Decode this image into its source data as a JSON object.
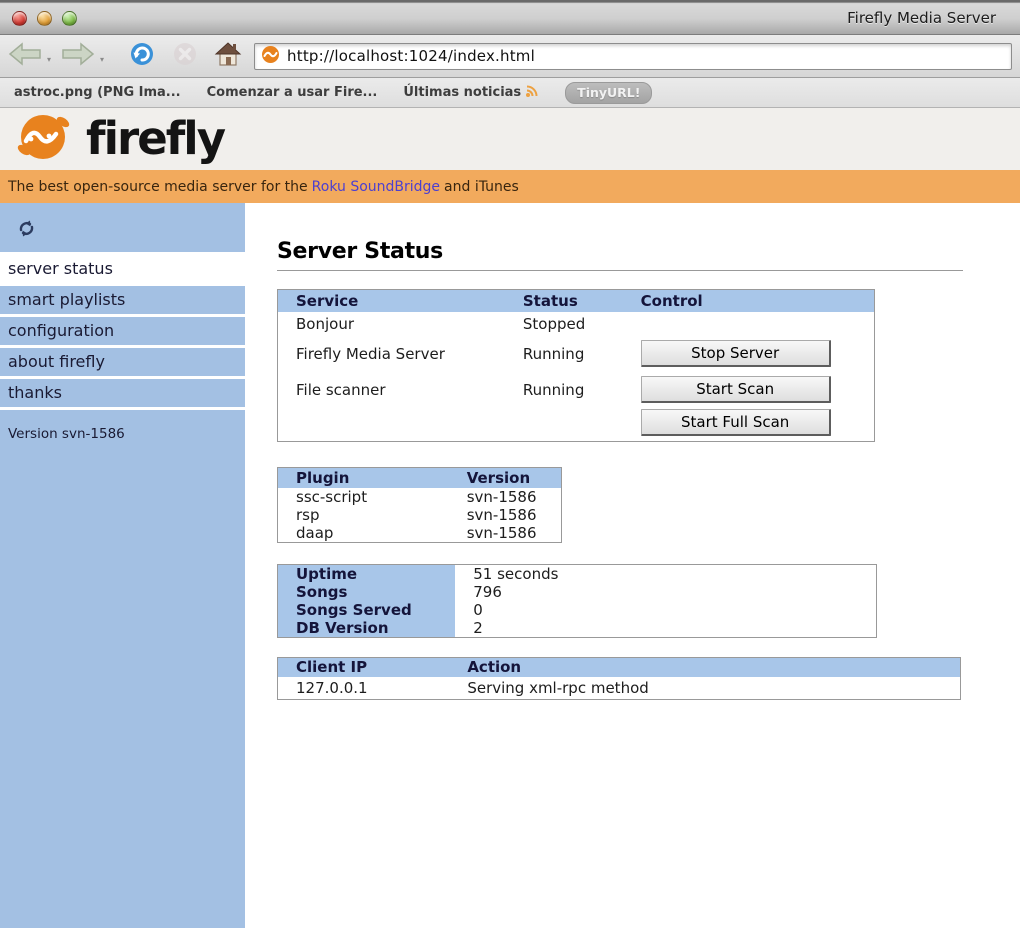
{
  "window": {
    "title": "Firefly Media Server"
  },
  "browser": {
    "url": "http://localhost:1024/index.html",
    "bookmarks": [
      {
        "label": "astroc.png (PNG Ima..."
      },
      {
        "label": "Comenzar a usar Fire..."
      },
      {
        "label": "Últimas noticias"
      },
      {
        "label": "TinyURL!"
      }
    ]
  },
  "logo": {
    "wordmark": "firefly"
  },
  "banner": {
    "prefix": "The best open-source media server for the",
    "link": "Roku SoundBridge",
    "suffix": "and iTunes"
  },
  "sidebar": {
    "items": [
      {
        "label": "server status",
        "selected": true
      },
      {
        "label": "smart playlists",
        "selected": false
      },
      {
        "label": "configuration",
        "selected": false
      },
      {
        "label": "about firefly",
        "selected": false
      },
      {
        "label": "thanks",
        "selected": false
      }
    ],
    "version": "Version svn-1586"
  },
  "main": {
    "title": "Server Status",
    "service_table": {
      "headers": {
        "service": "Service",
        "status": "Status",
        "control": "Control"
      },
      "rows": [
        {
          "service": "Bonjour",
          "status": "Stopped",
          "control": ""
        },
        {
          "service": "Firefly Media Server",
          "status": "Running",
          "control": "Stop Server"
        },
        {
          "service": "File scanner",
          "status": "Running",
          "control": "Start Scan"
        },
        {
          "service": "",
          "status": "",
          "control": "Start Full Scan"
        }
      ]
    },
    "plugin_table": {
      "headers": {
        "plugin": "Plugin",
        "version": "Version"
      },
      "rows": [
        {
          "plugin": "ssc-script",
          "version": "svn-1586"
        },
        {
          "plugin": "rsp",
          "version": "svn-1586"
        },
        {
          "plugin": "daap",
          "version": "svn-1586"
        }
      ]
    },
    "stats_table": {
      "rows": [
        {
          "label": "Uptime",
          "value": "51 seconds"
        },
        {
          "label": "Songs",
          "value": "796"
        },
        {
          "label": "Songs Served",
          "value": "0"
        },
        {
          "label": "DB Version",
          "value": "2"
        }
      ]
    },
    "client_table": {
      "headers": {
        "ip": "Client IP",
        "action": "Action"
      },
      "rows": [
        {
          "ip": "127.0.0.1",
          "action": "Serving xml-rpc method"
        }
      ]
    }
  },
  "colors": {
    "accent_orange": "#e8821e",
    "banner_bg": "#f2aa5d",
    "sidebar_bg": "#a3c0e3",
    "table_header_bg": "#a8c6e9",
    "banner_link": "#4c3fd0"
  }
}
